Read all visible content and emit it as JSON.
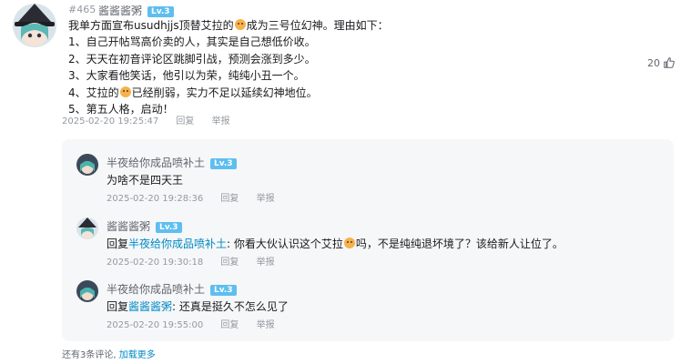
{
  "main_comment": {
    "floor": "#465",
    "username": "酱酱酱粥",
    "level": "Lv.3",
    "lines": [
      [
        "我单方面宣布usudhjjs顶替艾拉的",
        "成为三号位幻神。理由如下："
      ],
      [
        "1、自己开帖骂高价卖的人，其实是自己想低价收。"
      ],
      [
        "2、天天在初音评论区跳脚引战，预测会涨到多少。"
      ],
      [
        "3、大家看他笑话，他引以为荣，纯纯小丑一个。"
      ],
      [
        "4、艾拉的",
        "已经削弱，实力不足以延续幻神地位。"
      ],
      [
        "5、第五人格，启动！"
      ]
    ],
    "time": "2025-02-20 19:25:47",
    "reply_label": "回复",
    "report_label": "举报",
    "likes": "20",
    "icons": {
      "like": "thumbs-up-icon",
      "emoji": "dog-emoji-icon"
    }
  },
  "replies": [
    {
      "username": "半夜给你成品喷补土",
      "level": "Lv.3",
      "prefix": "",
      "mention": "",
      "text_parts": [
        "为啥不是四天王"
      ],
      "time": "2025-02-20 19:28:36",
      "reply_label": "回复",
      "report_label": "举报"
    },
    {
      "username": "酱酱酱粥",
      "level": "Lv.3",
      "prefix": "回复",
      "mention": "半夜给你成品喷补土",
      "text_parts": [
        ": 你看大伙认识这个艾拉",
        "吗，不是纯纯退坏境了？该给新人让位了。"
      ],
      "time": "2025-02-20 19:30:18",
      "reply_label": "回复",
      "report_label": "举报"
    },
    {
      "username": "半夜给你成品喷补土",
      "level": "Lv.3",
      "prefix": "回复",
      "mention": "酱酱酱粥",
      "text_parts": [
        ": 还真是挺久不怎么见了"
      ],
      "time": "2025-02-20 19:55:00",
      "reply_label": "回复",
      "report_label": "举报"
    }
  ],
  "footer": {
    "more_text": "还有3条评论,",
    "load_more": "加载更多"
  }
}
